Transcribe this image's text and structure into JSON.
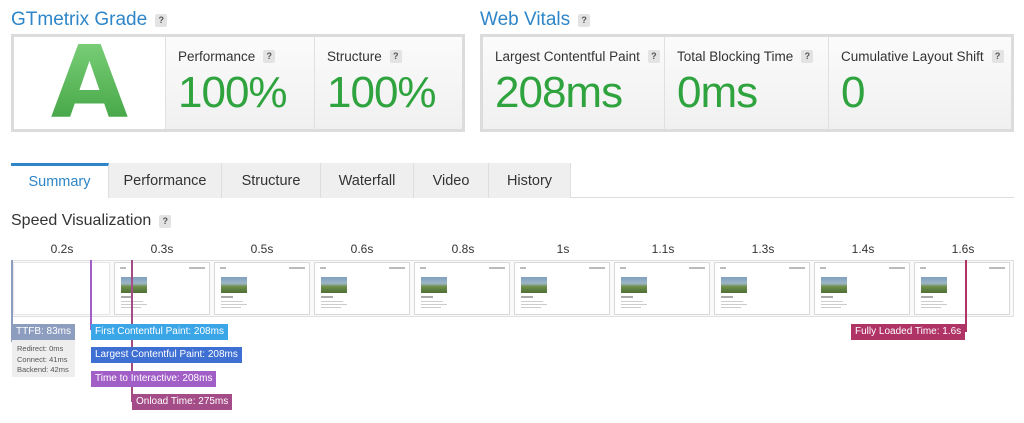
{
  "grade": {
    "title": "GTmetrix Grade",
    "letter": "A",
    "performance_label": "Performance",
    "performance_value": "100%",
    "structure_label": "Structure",
    "structure_value": "100%"
  },
  "vitals": {
    "title": "Web Vitals",
    "lcp_label": "Largest Contentful Paint",
    "lcp_value": "208ms",
    "tbt_label": "Total Blocking Time",
    "tbt_value": "0ms",
    "cls_label": "Cumulative Layout Shift",
    "cls_value": "0"
  },
  "help_glyph": "?",
  "tabs": [
    "Summary",
    "Performance",
    "Structure",
    "Waterfall",
    "Video",
    "History"
  ],
  "active_tab": "Summary",
  "speed": {
    "title": "Speed Visualization",
    "ticks": [
      "0.2s",
      "0.3s",
      "0.5s",
      "0.6s",
      "0.8s",
      "1s",
      "1.1s",
      "1.3s",
      "1.4s",
      "1.6s"
    ],
    "ttfb": "TTFB: 83ms",
    "redirect": "Redirect: 0ms",
    "connect": "Connect: 41ms",
    "backend": "Backend: 42ms",
    "fcp": "First Contentful Paint: 208ms",
    "lcp": "Largest Contentful Paint: 208ms",
    "tti": "Time to Interactive: 208ms",
    "onload": "Onload Time: 275ms",
    "fully_loaded": "Fully Loaded Time: 1.6s"
  },
  "colors": {
    "accent": "#2e86c8",
    "good": "#2fa33e",
    "ttfb": "#8d9dbf",
    "fcp": "#3aa6e8",
    "lcp": "#3e6fd3",
    "tti": "#a25ec7",
    "onload": "#a44c87",
    "fully_loaded": "#b03366"
  }
}
